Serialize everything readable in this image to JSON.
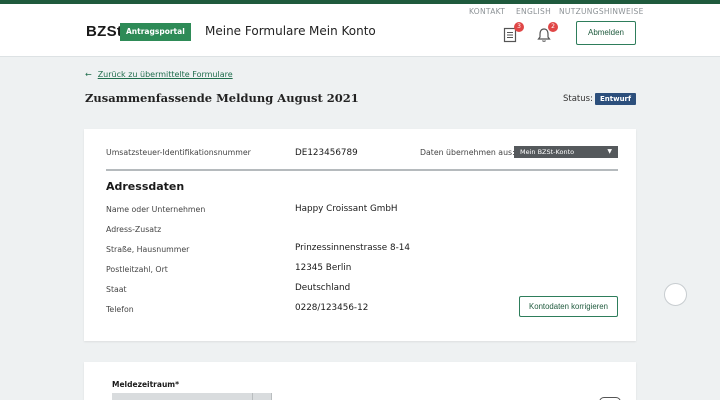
{
  "header": {
    "utility_links": [
      "KONTAKT",
      "ENGLISH",
      "NUTZUNGSHINWEISE"
    ],
    "logo": "BZSt",
    "portal_badge": "Antragsportal",
    "nav": [
      "Meine Formulare",
      "Mein Konto"
    ],
    "documents_count": "3",
    "notifications_count": "2",
    "logout_label": "Abmelden"
  },
  "page": {
    "back_link": "Zurück zu übermittelte Formulare",
    "title": "Zusammenfassende Meldung August 2021",
    "status_label": "Status:",
    "status_value": "Entwurf"
  },
  "card": {
    "vat_label": "Umsatzsteuer-Identifikationsnummer",
    "vat_value": "DE123456789",
    "import_label": "Daten übernehmen aus:",
    "import_select": "Mein BZSt-Konto",
    "section_title": "Adressdaten",
    "rows": [
      {
        "label": "Name oder Unternehmen",
        "value": "Happy Croissant GmbH"
      },
      {
        "label": "Adress-Zusatz",
        "value": ""
      },
      {
        "label": "Straße, Hausnummer",
        "value": "Prinzessinnenstrasse 8-14"
      },
      {
        "label": "Postleitzahl, Ort",
        "value": "12345 Berlin"
      },
      {
        "label": "Staat",
        "value": "Deutschland"
      },
      {
        "label": "Telefon",
        "value": "0228/123456-12"
      }
    ],
    "correct_button": "Kontodaten korrigieren"
  },
  "period": {
    "label": "Meldezeitraum*"
  },
  "colors": {
    "brand_green": "#1f5a3d",
    "badge_green": "#2e8b57",
    "status_blue": "#2c4f7c",
    "alert_red": "#e04646"
  }
}
